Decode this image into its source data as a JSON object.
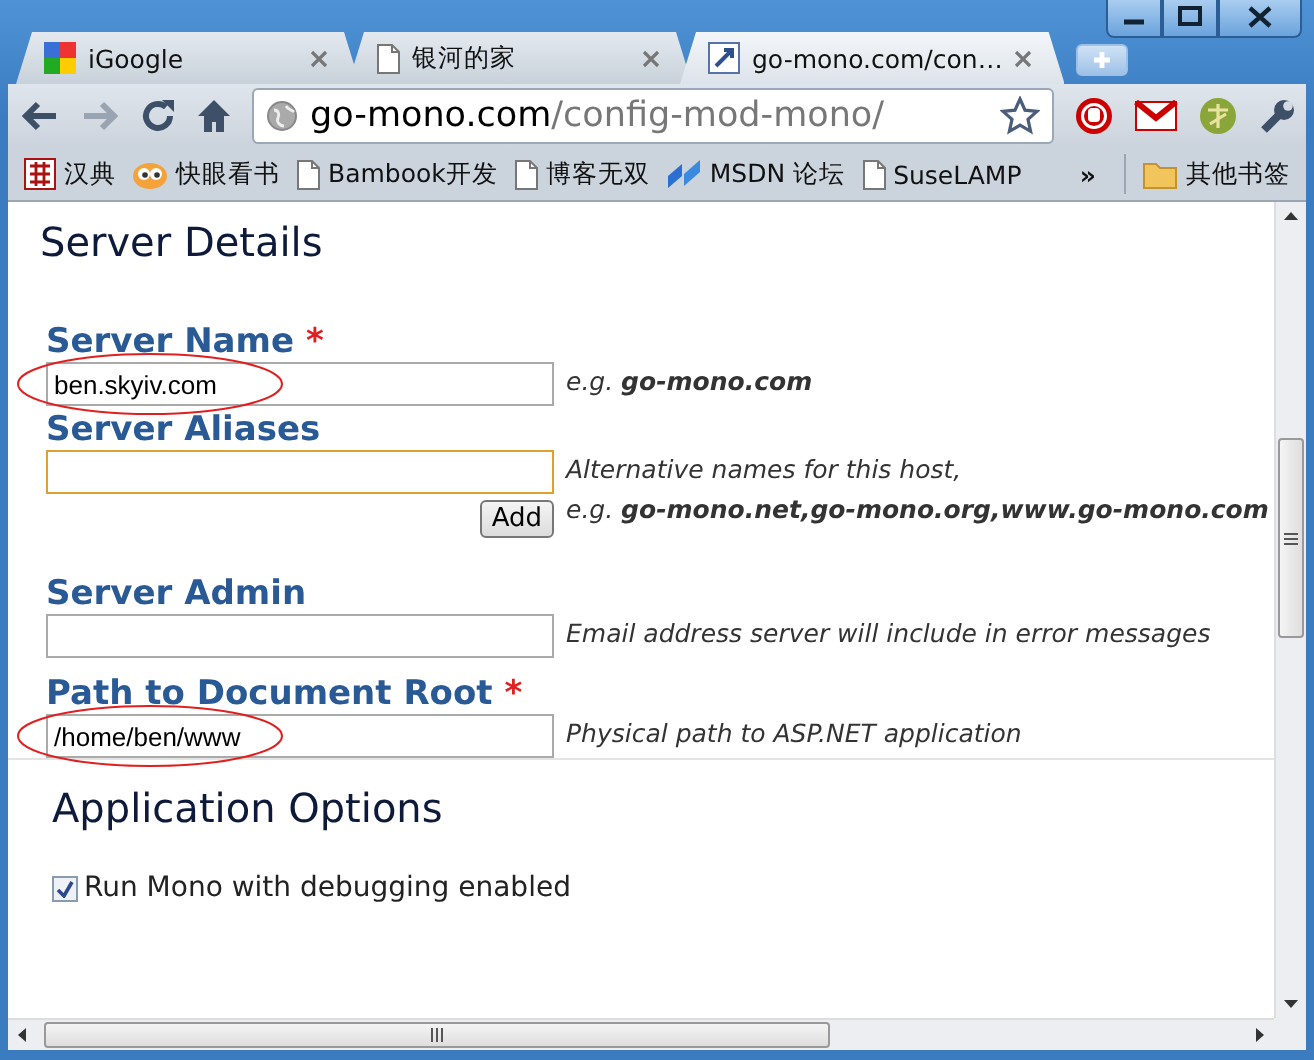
{
  "tabs": [
    {
      "label": "iGoogle",
      "kind": "google",
      "selected": false
    },
    {
      "label": "银河的家",
      "kind": "page",
      "selected": false
    },
    {
      "label": "go-mono.com/con…",
      "kind": "mono",
      "selected": true
    }
  ],
  "address": {
    "host": "go-mono.com",
    "path": "/config-mod-mono/"
  },
  "bookmarks": [
    {
      "label": "汉典",
      "kind": "dict"
    },
    {
      "label": "快眼看书",
      "kind": "eyes"
    },
    {
      "label": "Bambook开发",
      "kind": "page"
    },
    {
      "label": "博客无双",
      "kind": "page"
    },
    {
      "label": "MSDN 论坛",
      "kind": "msdn"
    },
    {
      "label": "SuseLAMP",
      "kind": "page"
    }
  ],
  "bookmarks_overflow": "»",
  "other_bookmarks": "其他书签",
  "sections": [
    {
      "title": "Server Details",
      "fields": [
        {
          "label": "Server Name",
          "required_mark": "*",
          "value": "ben.skyiv.com",
          "focused": false,
          "circled": true,
          "hint": [
            "e.g. **go-mono.com**"
          ]
        },
        {
          "label": "Server Aliases",
          "focused": true,
          "circled": false,
          "hint": [
            "Alternative names for this host,",
            "e.g. **go-mono.net,go-mono.org,www.go-mono.com**"
          ],
          "button": "Add"
        },
        {
          "label": "Server Admin",
          "focused": false,
          "circled": false,
          "hint": [
            "Email address server will include in error messages"
          ]
        },
        {
          "label": "Path to Document Root",
          "required_mark": "*",
          "value": "/home/ben/www",
          "focused": false,
          "circled": true,
          "hint": [
            "Physical path to ASP.NET application"
          ]
        }
      ]
    },
    {
      "title": "Application Options",
      "options": [
        {
          "label": "Run Mono with debugging enabled",
          "checked": true
        }
      ]
    }
  ]
}
